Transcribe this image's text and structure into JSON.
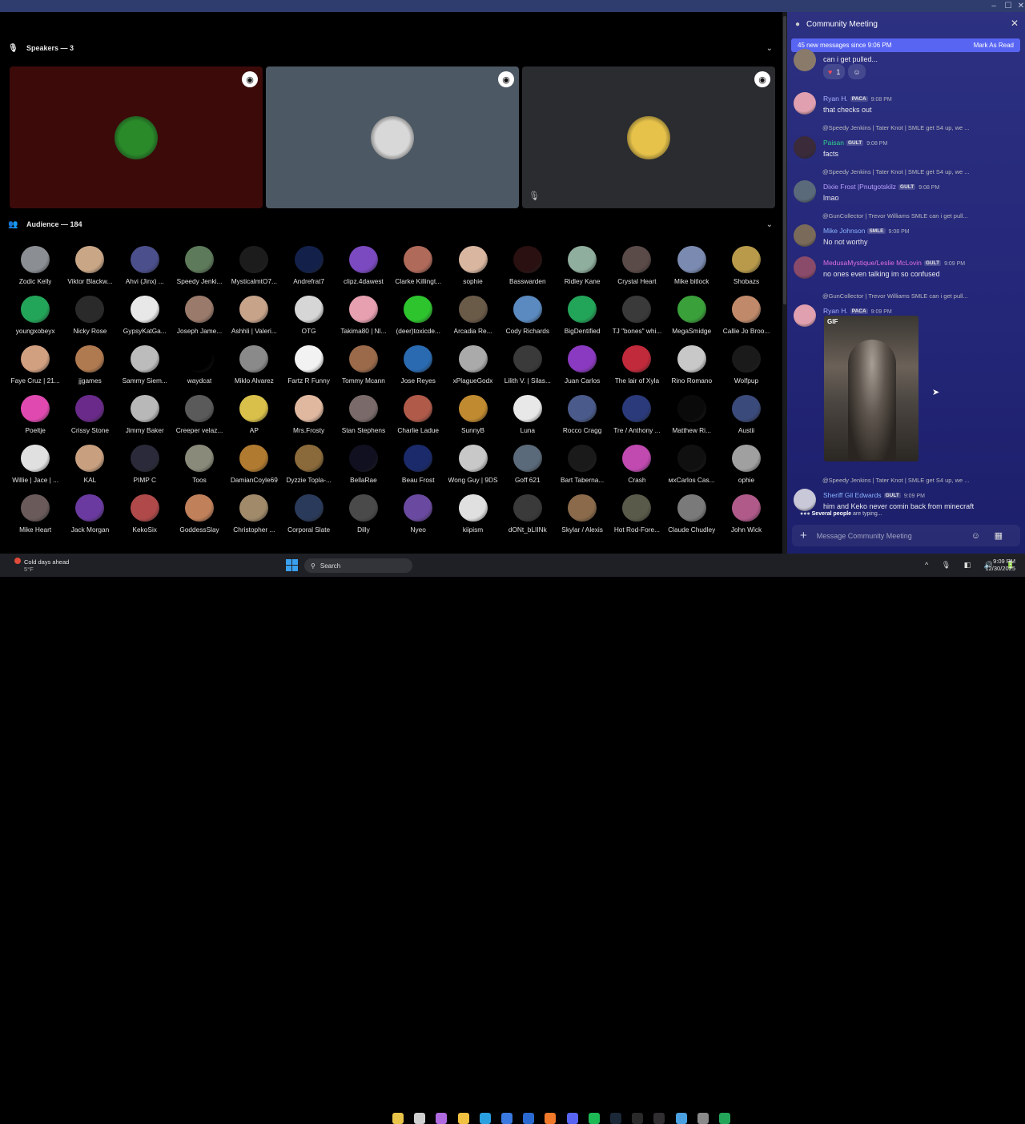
{
  "stage": {
    "speakers_label": "Speakers — 3",
    "audience_label": "Audience — 184",
    "speakers": [
      {
        "bg": "#3d0a0a",
        "avatar": "#2a8a2a"
      },
      {
        "bg": "#4c5864",
        "avatar": "#d8d8d8"
      },
      {
        "bg": "#2a2c30",
        "avatar": "#e6c24a"
      }
    ],
    "audience": [
      {
        "name": "Zodic Kelly",
        "c": "#8b8f94"
      },
      {
        "name": "Viktor Blackw...",
        "c": "#c9a686"
      },
      {
        "name": "Ahvi (Jinx) ...",
        "c": "#4b4f8c"
      },
      {
        "name": "Speedy Jenki...",
        "c": "#5d7a5a"
      },
      {
        "name": "MysticalmtO7...",
        "c": "#1c1c1c"
      },
      {
        "name": "Andrefrat7",
        "c": "#13214a"
      },
      {
        "name": "clipz.4dawest",
        "c": "#7b4ac0"
      },
      {
        "name": "Clarke Killingt...",
        "c": "#b06a5a"
      },
      {
        "name": "sophie",
        "c": "#d8b6a0"
      },
      {
        "name": "Basswarden",
        "c": "#2a1010"
      },
      {
        "name": "Ridley Kane",
        "c": "#8fae9e"
      },
      {
        "name": "Crystal Heart",
        "c": "#5a4a48"
      },
      {
        "name": "Mike bitlock",
        "c": "#7a8ab0"
      },
      {
        "name": "Shobazs",
        "c": "#b89a4a"
      },
      {
        "name": "youngxobeyx",
        "c": "#23a559"
      },
      {
        "name": "Nicky Rose",
        "c": "#2a2a2a"
      },
      {
        "name": "GypsyKatGa...",
        "c": "#e8e8e8"
      },
      {
        "name": "Joseph Jame...",
        "c": "#9a7a6a"
      },
      {
        "name": "Ashhli | Valeri...",
        "c": "#c7a38a"
      },
      {
        "name": "OTG",
        "c": "#d6d6d6"
      },
      {
        "name": "Takima80 | Nl...",
        "c": "#e6a0b0"
      },
      {
        "name": "(deer)toxicde...",
        "c": "#2ec42e"
      },
      {
        "name": "Arcadia Re...",
        "c": "#6a5a48"
      },
      {
        "name": "Cody Richards",
        "c": "#5a8ac0"
      },
      {
        "name": "BigDentified",
        "c": "#23a559"
      },
      {
        "name": "TJ \"bones\" whi...",
        "c": "#3a3a3a"
      },
      {
        "name": "MegaSmidge",
        "c": "#3aa03a"
      },
      {
        "name": "Callie Jo Broo...",
        "c": "#c08a6a"
      },
      {
        "name": "Faye Cruz | 21...",
        "c": "#d0a080"
      },
      {
        "name": "jjgames",
        "c": "#b07a50"
      },
      {
        "name": "Sammy Siem...",
        "c": "#bcbcbc"
      },
      {
        "name": "waydcat",
        "c": "#000000"
      },
      {
        "name": "Miklo Alvarez",
        "c": "#8a8a8a"
      },
      {
        "name": "Fartz R Funny",
        "c": "#f2f2f2"
      },
      {
        "name": "Tommy Mcann",
        "c": "#9a6a4a"
      },
      {
        "name": "Jose Reyes",
        "c": "#2a6ab0"
      },
      {
        "name": "xPlagueGodx",
        "c": "#aaaaaa"
      },
      {
        "name": "Lilith V. | Silas...",
        "c": "#3a3a3a"
      },
      {
        "name": "Juan Carlos",
        "c": "#8a3ac0"
      },
      {
        "name": "The lair of Xyla",
        "c": "#c02a3a"
      },
      {
        "name": "Rino Romano",
        "c": "#c8c8c8"
      },
      {
        "name": "Wolfpup",
        "c": "#1a1a1a"
      },
      {
        "name": "Poeltje",
        "c": "#e04ab0"
      },
      {
        "name": "Crissy Stone",
        "c": "#6a2a8a"
      },
      {
        "name": "Jimmy Baker",
        "c": "#b8b8b8"
      },
      {
        "name": "Creeper velaz...",
        "c": "#5a5a5a"
      },
      {
        "name": "AP",
        "c": "#d8c04a"
      },
      {
        "name": "Mrs.Frosty",
        "c": "#e0b8a0"
      },
      {
        "name": "Stan Stephens",
        "c": "#7a6a6a"
      },
      {
        "name": "Charlie Ladue",
        "c": "#b05a4a"
      },
      {
        "name": "SunnyB",
        "c": "#c08a30"
      },
      {
        "name": "Luna",
        "c": "#e8e8e8"
      },
      {
        "name": "Rocco Cragg",
        "c": "#4a5a8a"
      },
      {
        "name": "Tre / Anthony ...",
        "c": "#2a3a7a"
      },
      {
        "name": "Matthew Ri...",
        "c": "#0a0a0a"
      },
      {
        "name": "Austii",
        "c": "#3a4a7a"
      },
      {
        "name": "Willie | Jace | ...",
        "c": "#e0e0e0"
      },
      {
        "name": "KAL",
        "c": "#c8a080"
      },
      {
        "name": "PIMP C",
        "c": "#2a2a3a"
      },
      {
        "name": "Toos",
        "c": "#8a8a7a"
      },
      {
        "name": "DamianCoyle69",
        "c": "#b07a30"
      },
      {
        "name": "Dyzzie Topla-...",
        "c": "#8a6a3a"
      },
      {
        "name": "BellaRae",
        "c": "#101020"
      },
      {
        "name": "Beau Frost",
        "c": "#1a2a6a"
      },
      {
        "name": "Wong Guy | 9DS",
        "c": "#c8c8c8"
      },
      {
        "name": "Goff 621",
        "c": "#5a6a7a"
      },
      {
        "name": "Bart Taberna...",
        "c": "#1a1a1a"
      },
      {
        "name": "Crash",
        "c": "#c04ab0"
      },
      {
        "name": "мxCarlos Cas...",
        "c": "#101010"
      },
      {
        "name": "ophie",
        "c": "#a0a0a0"
      },
      {
        "name": "Mike Heart",
        "c": "#6a5a5a"
      },
      {
        "name": "Jack Morgan",
        "c": "#6a3aa0"
      },
      {
        "name": "KekoSix",
        "c": "#b04a4a"
      },
      {
        "name": "GoddessSlay",
        "c": "#c0805a"
      },
      {
        "name": "Christopher ...",
        "c": "#a08a6a"
      },
      {
        "name": "Corporal Slate",
        "c": "#2a3a5a"
      },
      {
        "name": "Dilly",
        "c": "#4a4a4a"
      },
      {
        "name": "Nyeo",
        "c": "#6a4aa0"
      },
      {
        "name": "kiipism",
        "c": "#e0e0e0"
      },
      {
        "name": "dONt_bLIINk",
        "c": "#3a3a3a"
      },
      {
        "name": "Skylar / Alexis",
        "c": "#8a6a4a"
      },
      {
        "name": "Hot Rod-Fore...",
        "c": "#5a5a4a"
      },
      {
        "name": "Claude Chudley",
        "c": "#7a7a7a"
      },
      {
        "name": "John Wick",
        "c": "#b05a8a"
      }
    ]
  },
  "chat": {
    "title": "Community Meeting",
    "banner_text": "45 new messages since 9:06 PM",
    "mark_read": "Mark As Read",
    "first_text": "can i get pulled...",
    "reaction_count": "1",
    "messages": [
      {
        "author": "Ryan H.",
        "color": "#a8b4ff",
        "tags": [
          "PACA"
        ],
        "time": "9:08 PM",
        "text": "that checks out",
        "reply": "",
        "avatar": "#e0a0b0"
      },
      {
        "author": "Paisan",
        "color": "#2fd48a",
        "tags": [
          "GULT"
        ],
        "time": "9:08 PM",
        "text": "facts",
        "reply": "@Speedy Jenkins | Tater Knot | SMLE get S4 up, we ...",
        "avatar": "#3a2a3a"
      },
      {
        "author": "Dixie Frost |Pnutgotskilz",
        "color": "#b9a0ff",
        "tags": [
          "GULT"
        ],
        "time": "9:08 PM",
        "text": "lmao",
        "reply": "@Speedy Jenkins | Tater Knot | SMLE get S4 up, we ...",
        "avatar": "#5a6a7a"
      },
      {
        "author": "Mike Johnson",
        "color": "#8ab4ff",
        "tags": [
          "SMLE"
        ],
        "time": "9:08 PM",
        "text": "No not worthy",
        "reply": "@GunCollector | Trevor Williams SMLE can i get pull...",
        "avatar": "#7a6a5a"
      },
      {
        "author": "MedusaMystique/Leslie McLovin",
        "color": "#e070e0",
        "tags": [
          "GULT"
        ],
        "time": "9:09 PM",
        "text": "no ones even talking im so confused",
        "reply": "",
        "avatar": "#8a4a6a"
      },
      {
        "author": "Ryan H.",
        "color": "#a8b4ff",
        "tags": [
          "PACA"
        ],
        "time": "9:09 PM",
        "text": "",
        "reply": "@GunCollector | Trevor Williams SMLE can i get pull...",
        "avatar": "#e0a0b0"
      },
      {
        "author": "Sheriff Gil Edwards",
        "color": "#8ab4ff",
        "tags": [
          "GULT"
        ],
        "time": "9:09 PM",
        "text": "him and Keko never comin back from minecraft",
        "reply": "@Speedy Jenkins | Tater Knot | SMLE get S4 up, we ...",
        "avatar": "#c8c8d8"
      }
    ],
    "gif_label": "GIF",
    "typing_name": "Several people",
    "typing_rest": " are typing...",
    "composer_placeholder": "Message Community Meeting"
  },
  "taskbar": {
    "weather_line1": "Cold days ahead",
    "weather_line2": "5°F",
    "search": "Search",
    "time": "9:09 PM",
    "date": "12/30/2025"
  }
}
